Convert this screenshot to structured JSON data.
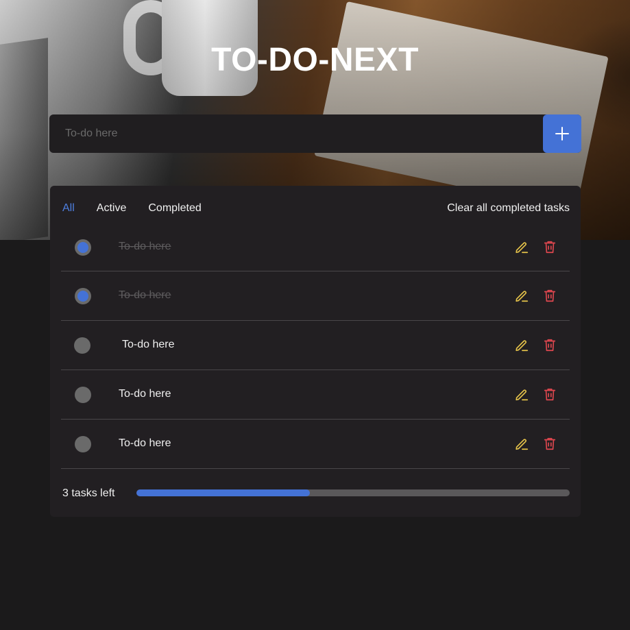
{
  "app": {
    "title": "TO-DO-NEXT"
  },
  "input": {
    "placeholder": "To-do here",
    "value": ""
  },
  "add_button": {
    "icon": "plus-icon"
  },
  "filters": [
    {
      "label": "All",
      "active": true
    },
    {
      "label": "Active",
      "active": false
    },
    {
      "label": "Completed",
      "active": false
    }
  ],
  "clear_completed_label": "Clear all completed tasks",
  "todos": [
    {
      "text": "To-do here",
      "completed": true
    },
    {
      "text": "To-do here",
      "completed": true
    },
    {
      "text": "To-do here",
      "completed": false
    },
    {
      "text": "To-do here",
      "completed": false
    },
    {
      "text": "To-do here",
      "completed": false
    }
  ],
  "icons": {
    "edit": "pencil-icon",
    "delete": "trash-icon"
  },
  "footer": {
    "tasks_left_label": "3 tasks left",
    "progress_fraction": 0.4
  },
  "colors": {
    "accent": "#4472d6",
    "edit_icon": "#e6c34a",
    "delete_icon": "#e0474f",
    "panel": "#221f22",
    "background": "#1b1a1b"
  }
}
